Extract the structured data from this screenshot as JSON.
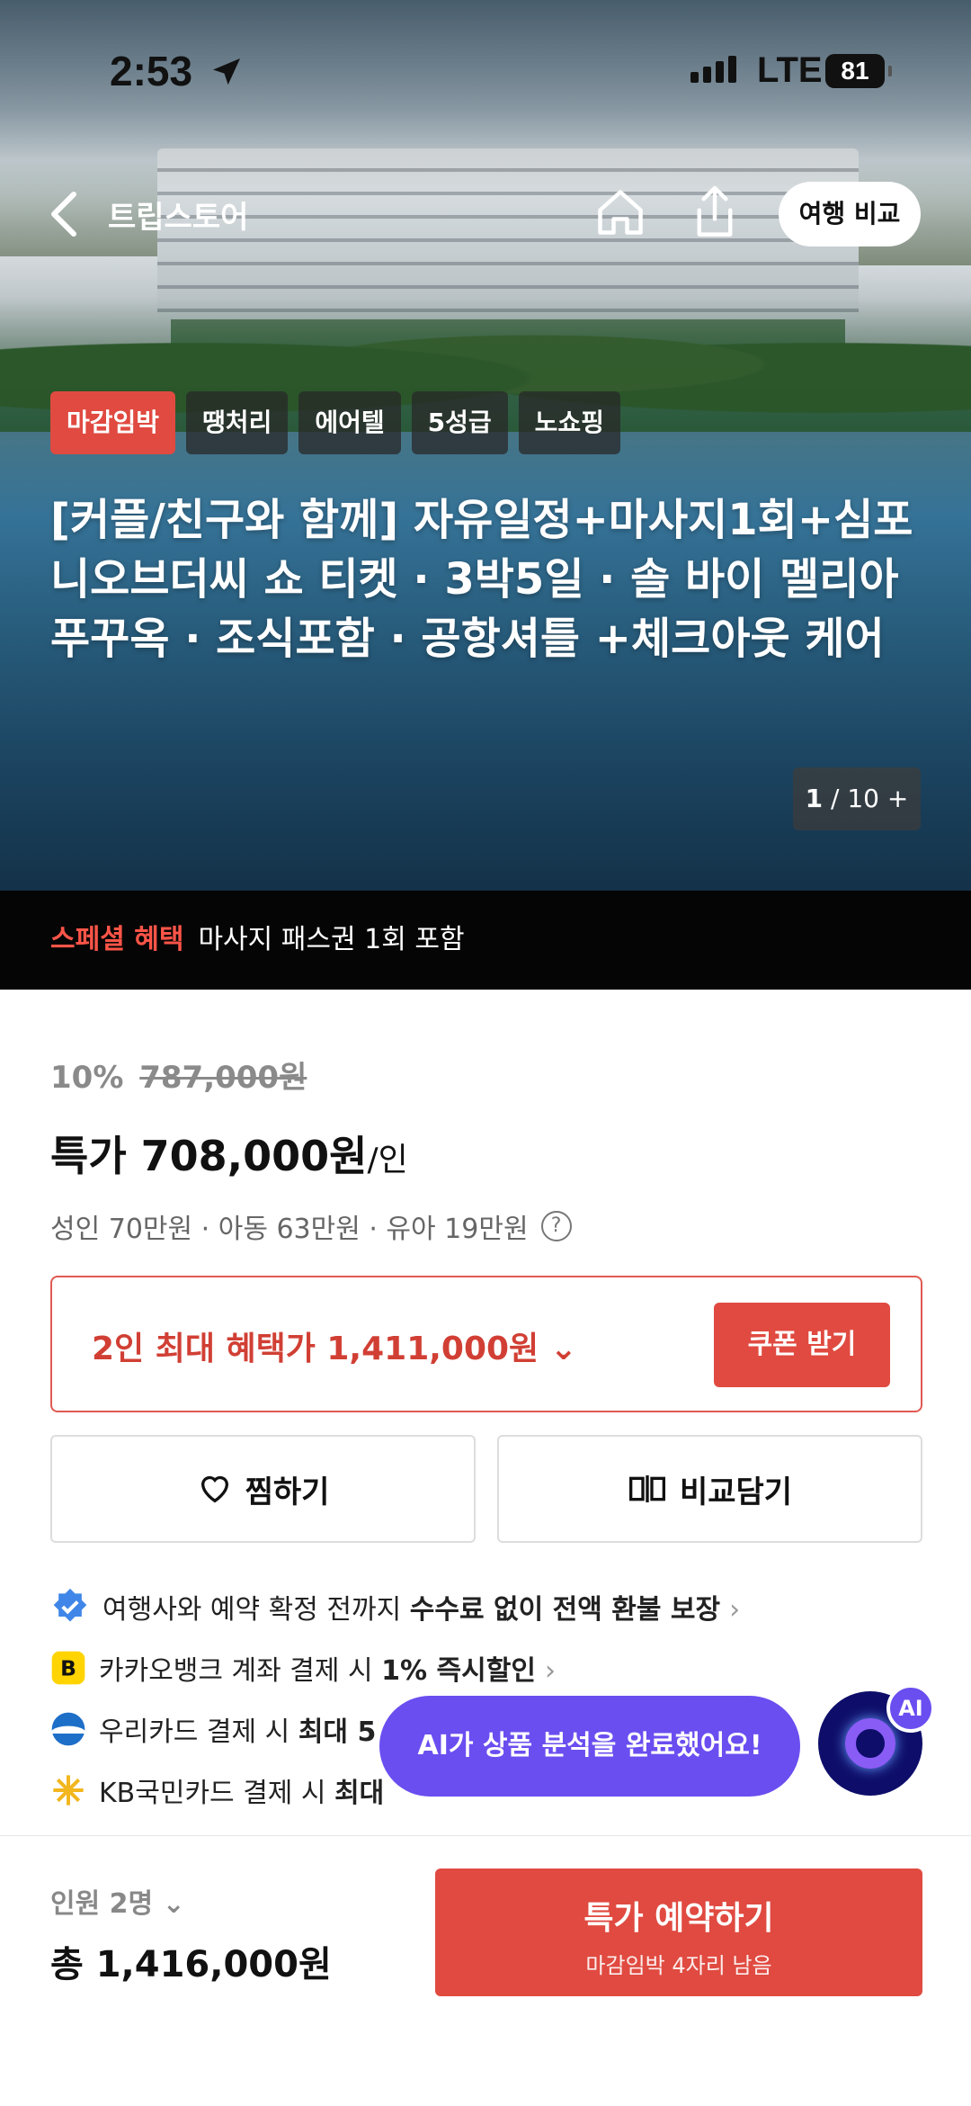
{
  "status_bar": {
    "time": "2:53",
    "network": "LTE",
    "battery": "81"
  },
  "nav": {
    "title": "트립스토어",
    "compare_button": "여행 비교"
  },
  "hero": {
    "tags": [
      "마감임박",
      "땡처리",
      "에어텔",
      "5성급",
      "노쇼핑"
    ],
    "title": "[커플/친구와 함께] 자유일정+마사지1회+심포니오브더씨 쇼 티켓 · 3박5일 · 솔 바이 멜리아 푸꾸옥 · 조식포함 · 공항셔틀 +체크아웃 케어",
    "counter_current": "1",
    "counter_total": "10"
  },
  "benefit_banner": {
    "label": "스페셜 혜택",
    "text": "마사지 패스권 1회 포함"
  },
  "price": {
    "discount": "10%",
    "original": "787,000원",
    "sale_label": "특가 708,000원",
    "sale_unit": "/인",
    "breakdown": "성인 70만원 · 아동 63만원 · 유아 19만원"
  },
  "coupon": {
    "text": "2인 최대 혜택가 1,411,000원",
    "button": "쿠폰 받기"
  },
  "actions": {
    "wishlist": "찜하기",
    "compare": "비교담기"
  },
  "perks": [
    {
      "pre": "여행사와 예약 확정 전까지 ",
      "bold": "수수료 없이 전액 환불 보장",
      "icon": "verified-badge"
    },
    {
      "pre": "카카오뱅크 계좌 결제 시 ",
      "bold": "1% 즉시할인",
      "icon": "kakaobank-logo"
    },
    {
      "pre": "우리카드 결제 시 ",
      "bold": "최대 5",
      "icon": "wooricard-logo"
    },
    {
      "pre": "KB국민카드 결제 시 ",
      "bold": "최대",
      "icon": "kbcard-logo"
    }
  ],
  "ai": {
    "bubble": "AI가 상품 분석을 완료했어요!",
    "badge": "AI"
  },
  "footer": {
    "people": "인원 2명",
    "total": "총 1,416,000원",
    "book_button": "특가 예약하기",
    "book_sub": "마감임박 4자리 남음"
  }
}
